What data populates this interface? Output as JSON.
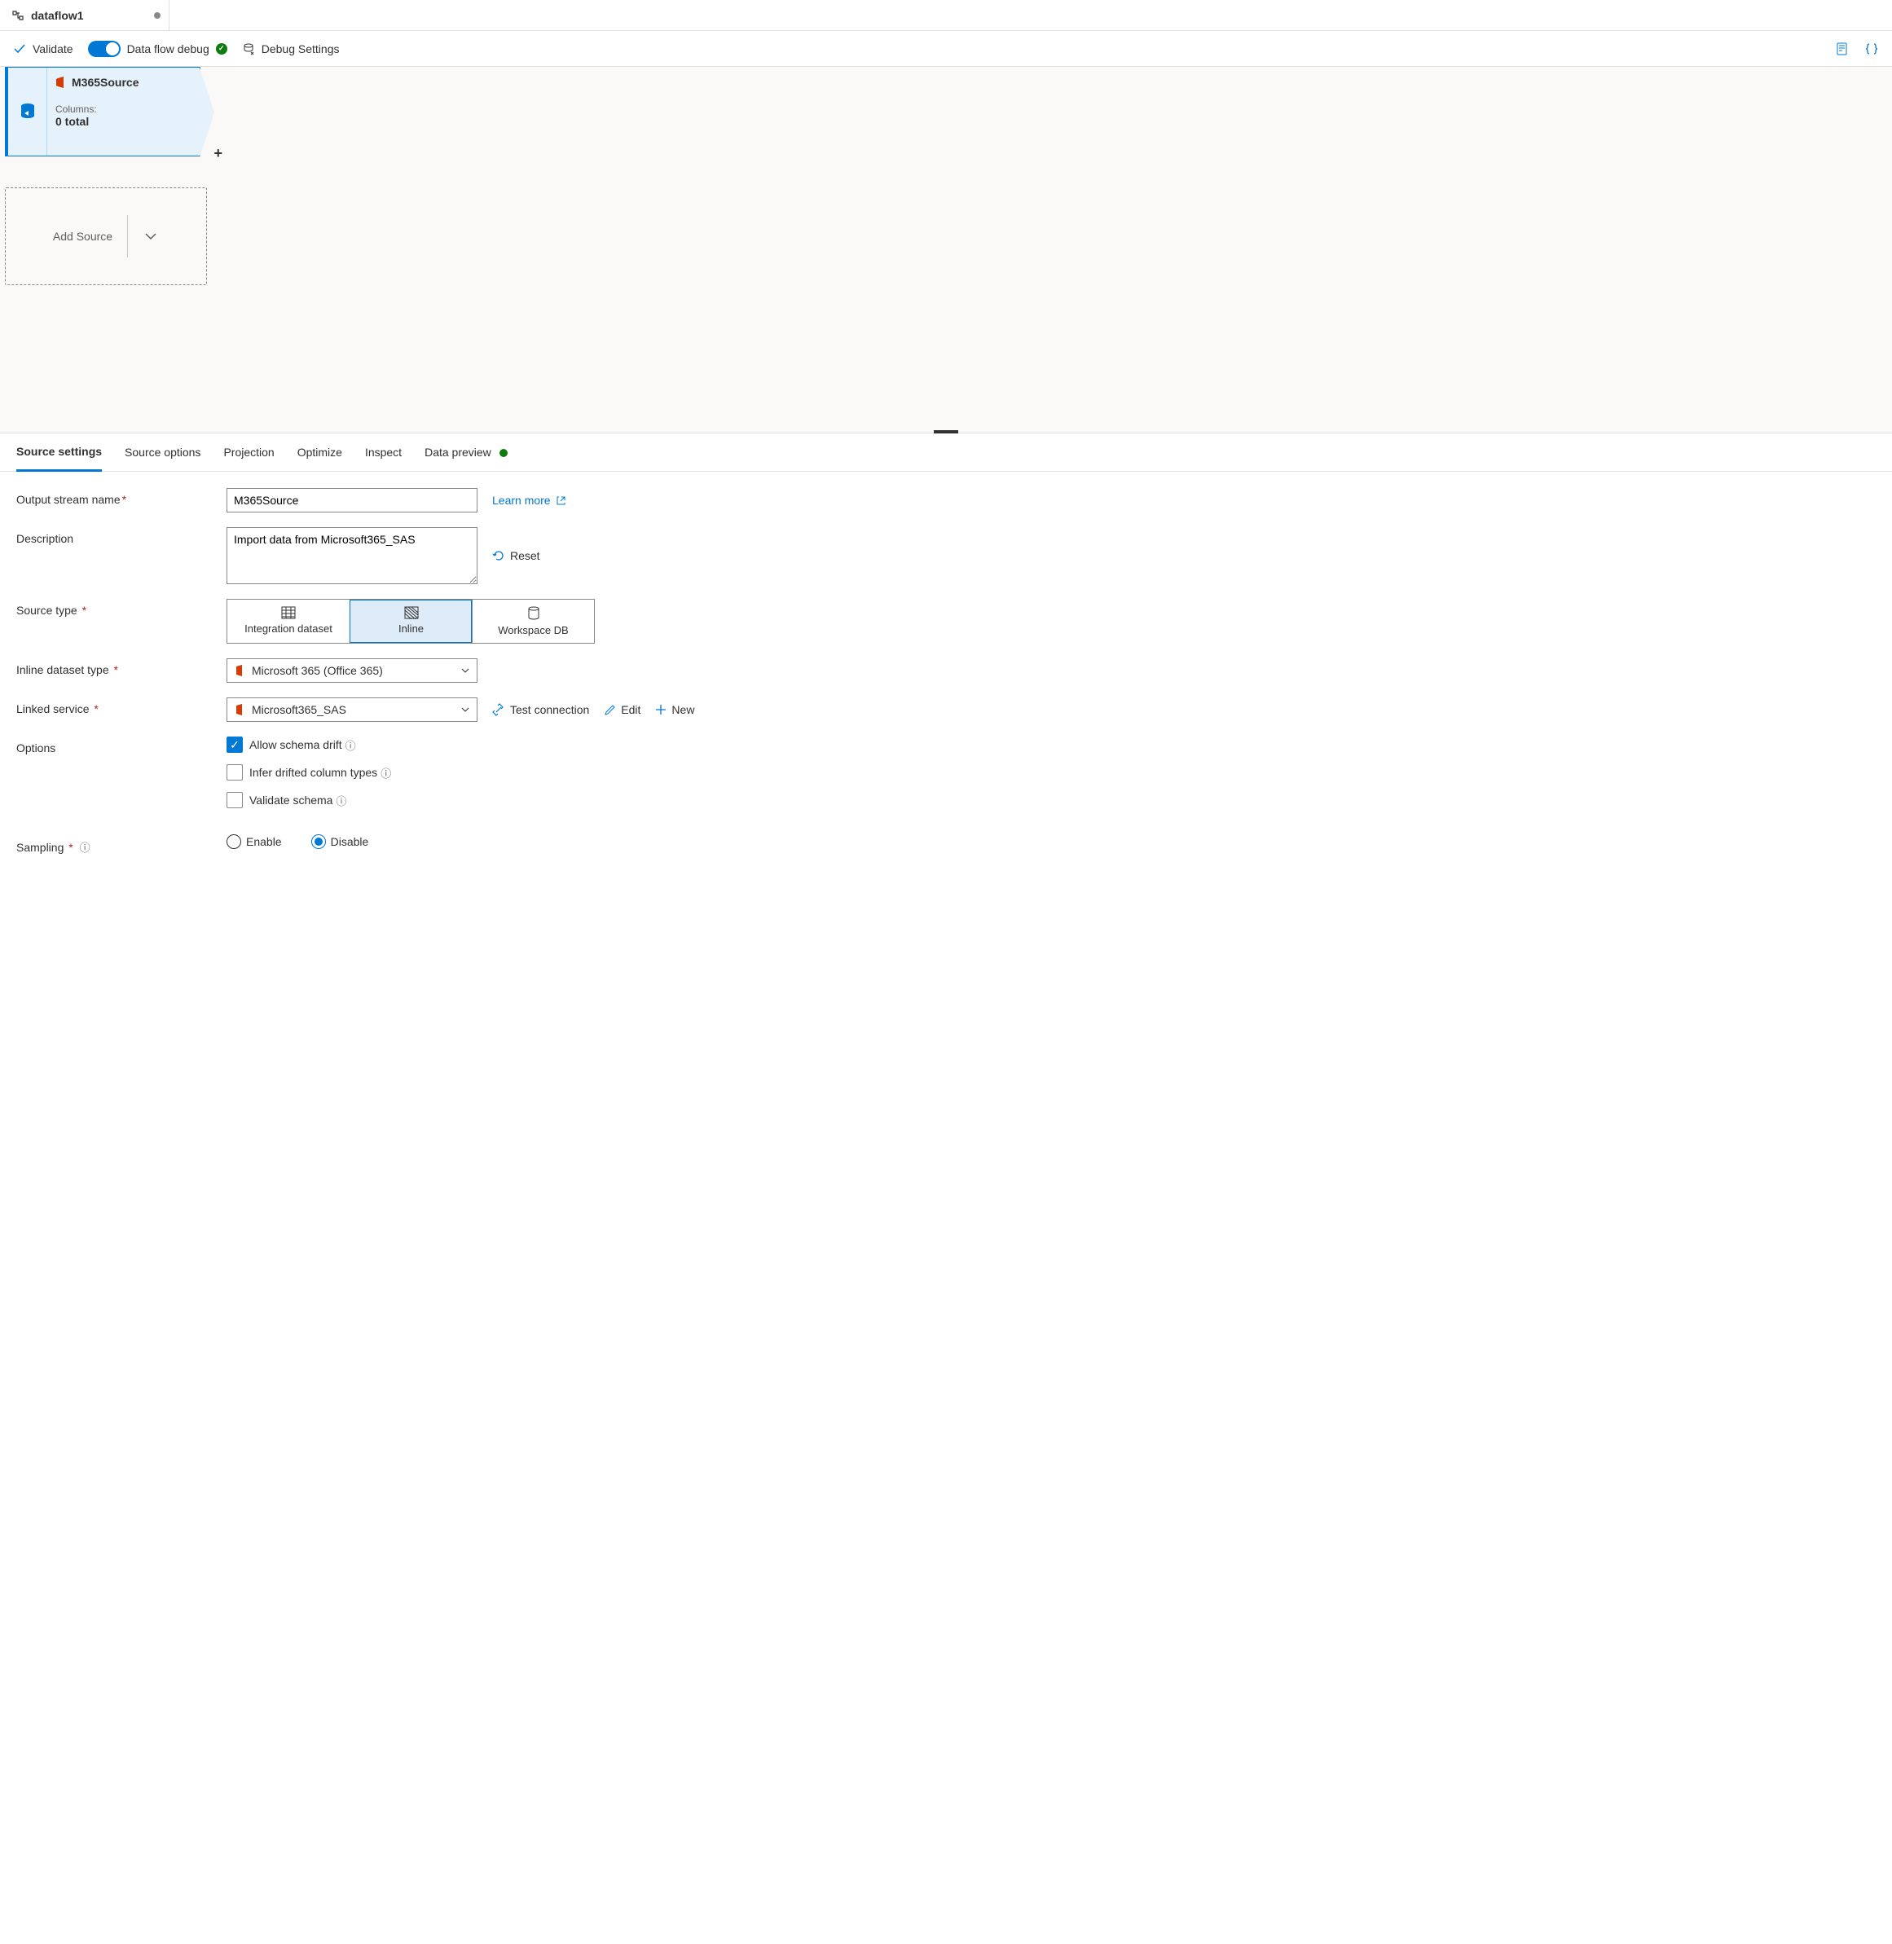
{
  "tab": {
    "title": "dataflow1"
  },
  "toolbar": {
    "validate": "Validate",
    "debug_label": "Data flow debug",
    "debug_settings": "Debug Settings"
  },
  "node": {
    "title": "M365Source",
    "columns_label": "Columns:",
    "columns_count": "0 total"
  },
  "add_source": "Add Source",
  "props_tabs": {
    "source_settings": "Source settings",
    "source_options": "Source options",
    "projection": "Projection",
    "optimize": "Optimize",
    "inspect": "Inspect",
    "data_preview": "Data preview"
  },
  "form": {
    "output_name_label": "Output stream name",
    "output_name_value": "M365Source",
    "learn_more": "Learn more",
    "description_label": "Description",
    "description_value": "Import data from Microsoft365_SAS",
    "reset": "Reset",
    "source_type_label": "Source type",
    "source_type": {
      "dataset": "Integration dataset",
      "inline": "Inline",
      "workspace": "Workspace DB"
    },
    "inline_type_label": "Inline dataset type",
    "inline_type_value": "Microsoft 365 (Office 365)",
    "linked_service_label": "Linked service",
    "linked_service_value": "Microsoft365_SAS",
    "test_connection": "Test connection",
    "edit": "Edit",
    "new": "New",
    "options_label": "Options",
    "allow_drift": "Allow schema drift",
    "infer_types": "Infer drifted column types",
    "validate_schema": "Validate schema",
    "sampling_label": "Sampling",
    "enable": "Enable",
    "disable": "Disable"
  }
}
